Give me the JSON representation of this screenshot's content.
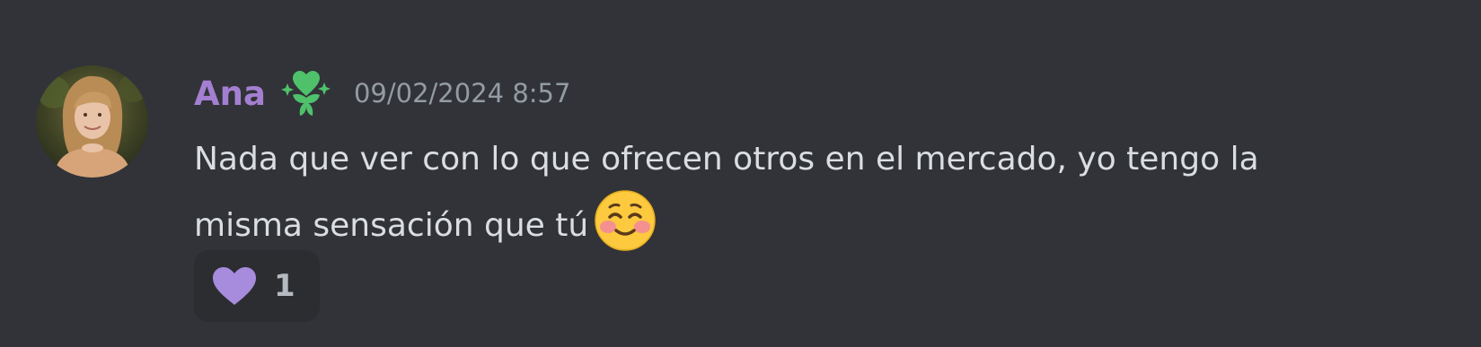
{
  "message": {
    "author": {
      "name": "Ana",
      "name_color": "#a47fd1",
      "role_icon": "sparkle-heart-flower-icon",
      "role_icon_color": "#4fc16b"
    },
    "timestamp": "09/02/2024 8:57",
    "content_lines": [
      "Nada que ver con lo que ofrecen otros en el mercado, yo tengo la",
      "misma sensación que tú"
    ],
    "inline_emoji": "smiling-face-with-smiling-eyes-emoji",
    "reactions": [
      {
        "emoji": "purple-heart-icon",
        "emoji_color": "#a78bdc",
        "count": "1"
      }
    ]
  },
  "theme": {
    "background": "#313338",
    "text": "#dbdee1",
    "muted_text": "#949ba4",
    "reaction_background": "#2b2d31"
  }
}
